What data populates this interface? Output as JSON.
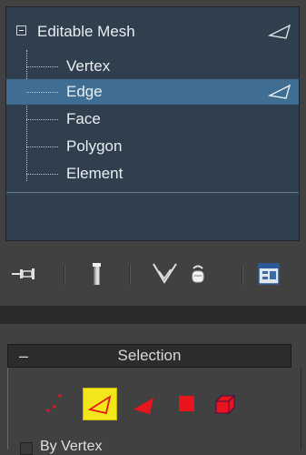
{
  "modifier_stack": {
    "root": {
      "label": "Editable Mesh",
      "icon": "edge-triangle-icon",
      "expanded": true
    },
    "items": [
      {
        "label": "Vertex",
        "selected": false
      },
      {
        "label": "Edge",
        "selected": true,
        "icon": "edge-triangle-icon"
      },
      {
        "label": "Face",
        "selected": false
      },
      {
        "label": "Polygon",
        "selected": false
      },
      {
        "label": "Element",
        "selected": false
      }
    ]
  },
  "toolbar": {
    "buttons": [
      {
        "name": "pin-stack",
        "icon": "pin-icon"
      },
      {
        "name": "show-end-result",
        "icon": "end-result-icon"
      },
      {
        "name": "make-unique",
        "icon": "make-unique-icon"
      },
      {
        "name": "remove-modifier",
        "icon": "trash-icon"
      },
      {
        "name": "configure-modifier-sets",
        "icon": "configure-sets-icon"
      }
    ]
  },
  "selection_rollout": {
    "collapse_symbol": "–",
    "title": "Selection",
    "modes": [
      {
        "name": "vertex",
        "icon": "vertex-dots-icon",
        "active": false
      },
      {
        "name": "edge",
        "icon": "edge-triangle-icon",
        "active": true
      },
      {
        "name": "face",
        "icon": "face-triangle-icon",
        "active": false
      },
      {
        "name": "polygon",
        "icon": "polygon-square-icon",
        "active": false
      },
      {
        "name": "element",
        "icon": "element-cube-icon",
        "active": false
      }
    ],
    "by_vertex_label": "By Vertex"
  },
  "colors": {
    "stack_bg": "#2f3f4d",
    "selected_row": "#3f6e92",
    "active_mode": "#f5e61a",
    "mode_red": "#e8141e"
  }
}
